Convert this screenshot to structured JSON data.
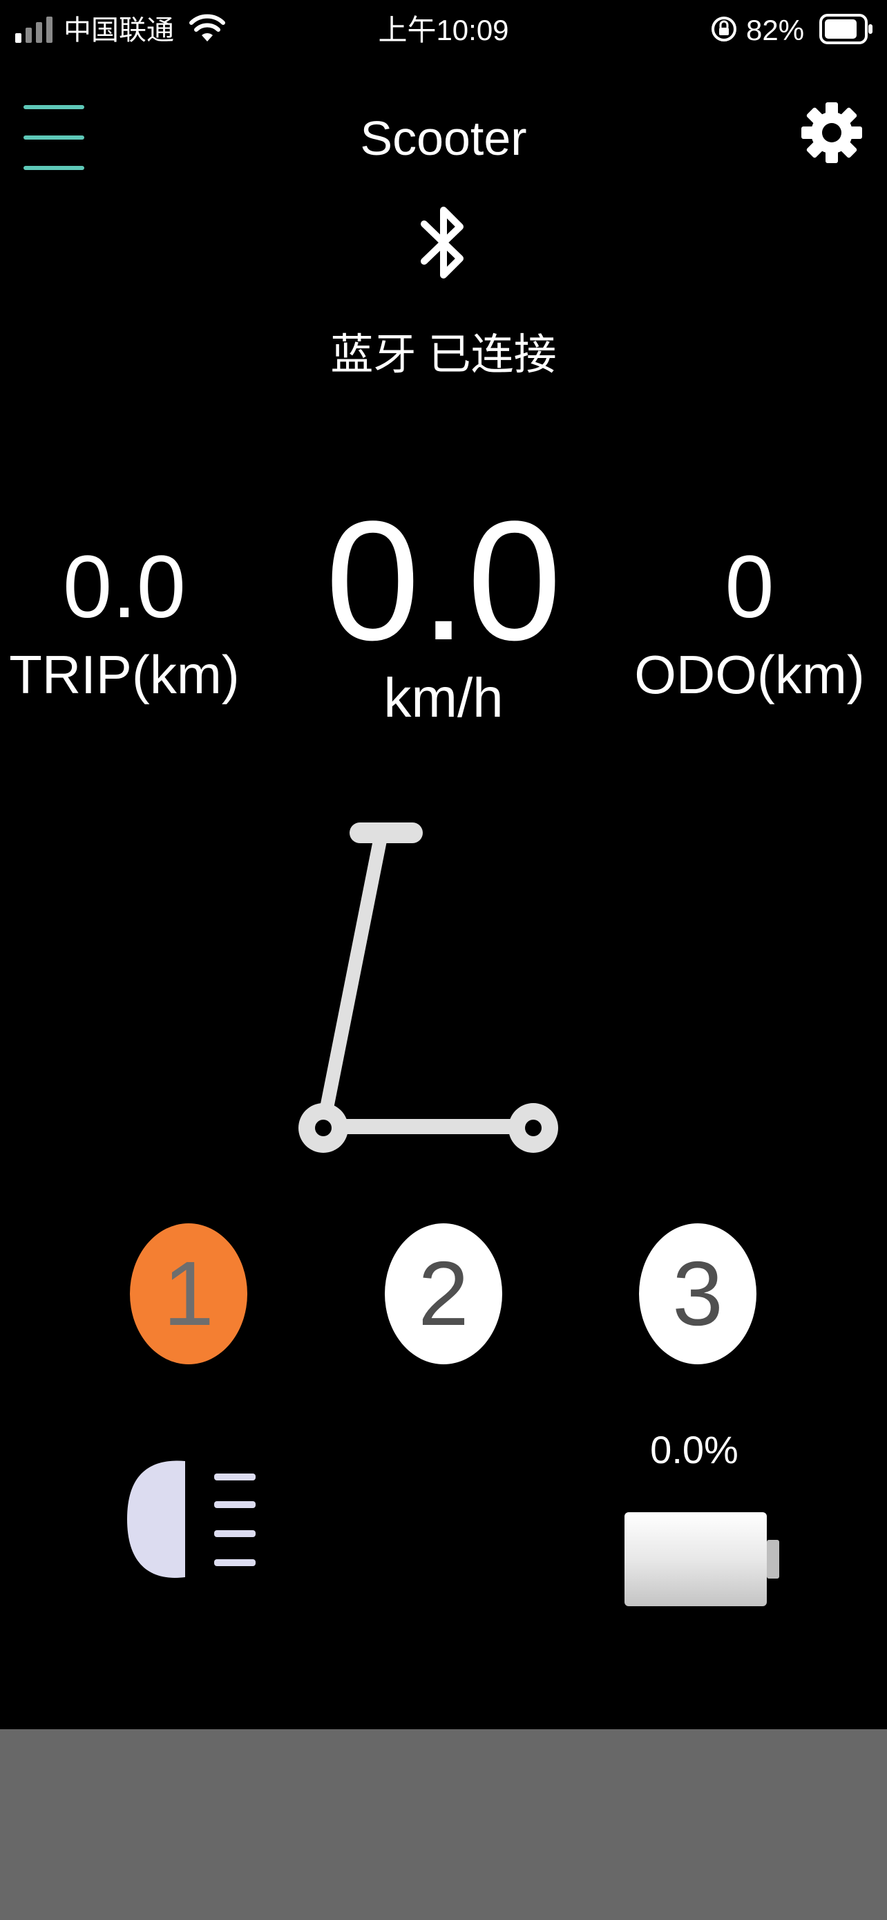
{
  "status_bar": {
    "carrier": "中国联通",
    "time": "上午10:09",
    "battery": "82%"
  },
  "header": {
    "title": "Scooter",
    "bluetooth_status": "蓝牙 已连接"
  },
  "stats": {
    "trip_value": "0.0",
    "trip_unit": "TRIP(km)",
    "speed_value": "0.0",
    "speed_unit": "km/h",
    "odo_value": "0",
    "odo_unit": "ODO(km)"
  },
  "modes": {
    "items": [
      "1",
      "2",
      "3"
    ],
    "selected": "1",
    "active_color": "#f47f32"
  },
  "battery": {
    "level_text": "0.0%",
    "level_fraction": 0.0
  },
  "icons": {
    "menu": "menu-icon",
    "settings": "gear-icon",
    "bluetooth": "bluetooth-icon",
    "headlight": "headlight-icon",
    "battery": "battery-icon"
  },
  "colors": {
    "background": "#000000",
    "menu_accent": "#5ec8b8",
    "mode_active": "#f47f32",
    "bottom_panel": "#686868"
  }
}
